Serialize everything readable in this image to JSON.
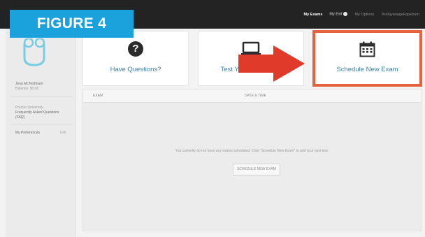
{
  "badge": {
    "text": "FIGURE 4"
  },
  "topnav": {
    "items": [
      "My Exams",
      "My Exif",
      "My Options",
      "Jtrafayanagekapetrum"
    ]
  },
  "sidebar": {
    "user_name": "Jena McTeahnum",
    "user_sub": "Balance: $0.00",
    "links": [
      "Proctor University",
      "Frequently Asked Questions",
      "(FAQ)"
    ],
    "prefs_label": "My Preferences",
    "prefs_action": "Edit"
  },
  "cards": [
    {
      "label": "Have Questions?",
      "icon": "question-circle-icon"
    },
    {
      "label": "Test Your Equipment",
      "icon": "laptop-icon"
    },
    {
      "label": "Schedule New Exam",
      "icon": "calendar-icon"
    }
  ],
  "table": {
    "columns": [
      "EXAM",
      "DATE & TIME"
    ],
    "empty_message": "You currently do not have any exams scheduled. Click \"Schedule New Exam\" to add your next test.",
    "button_label": "SCHEDULE NEW EXAM"
  },
  "colors": {
    "badge": "#1ba1dc",
    "highlight": "#e5623f",
    "arrow": "#e03a2b",
    "link": "#3c7fa8",
    "topbar": "#232323"
  }
}
